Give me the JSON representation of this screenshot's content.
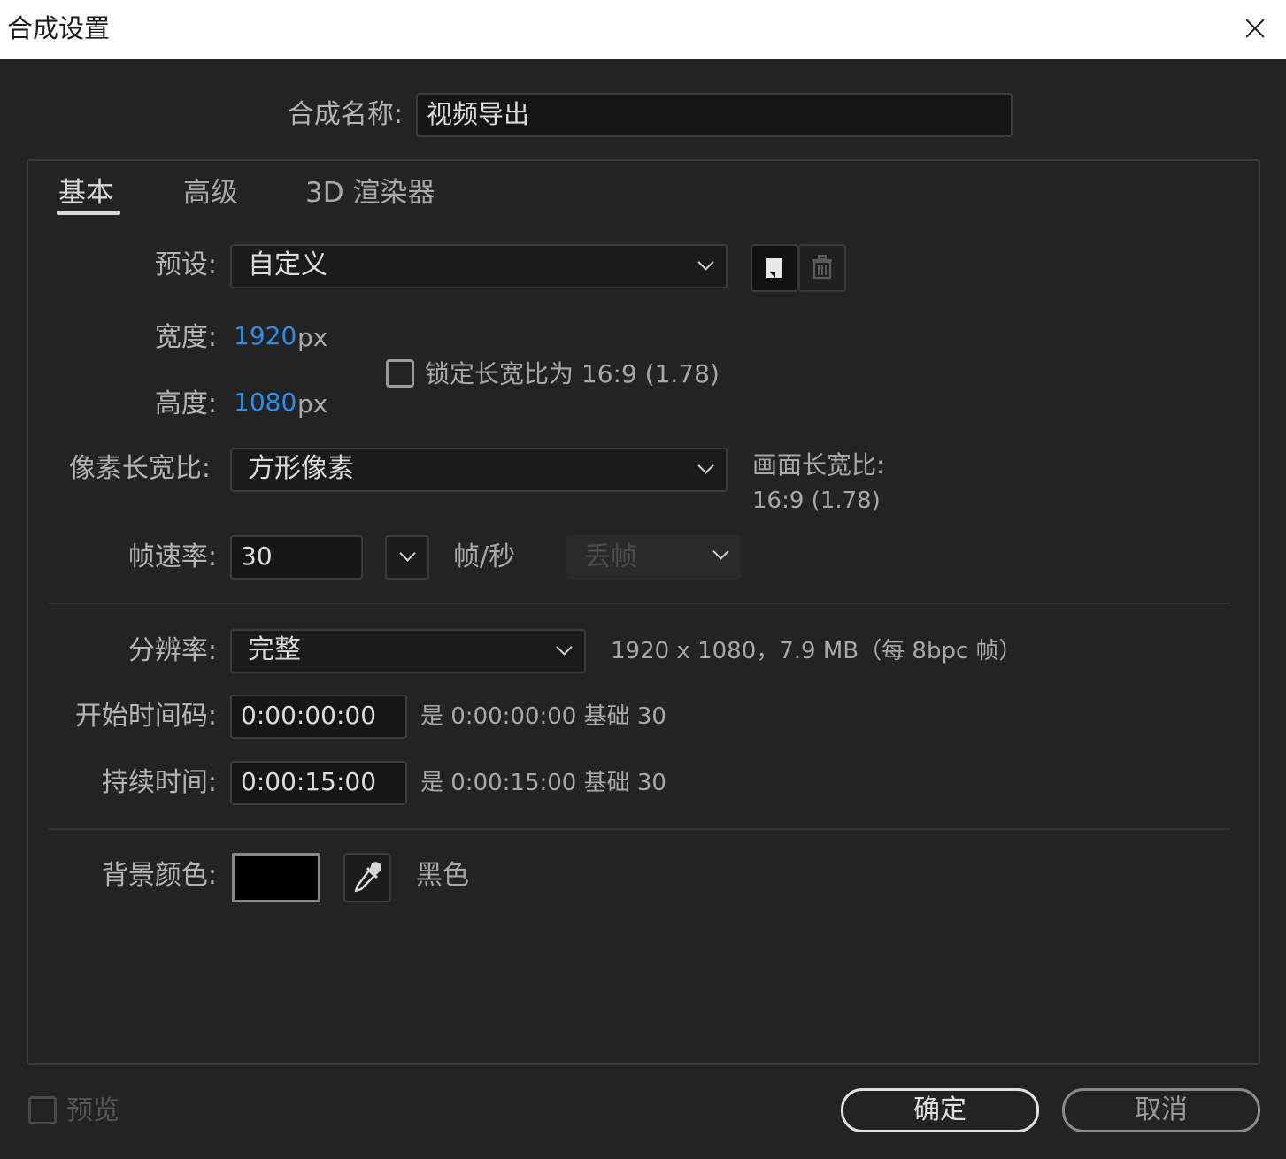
{
  "window": {
    "title": "合成设置"
  },
  "comp_name": {
    "label": "合成名称:",
    "value": "视频导出"
  },
  "tabs": [
    {
      "label": "基本"
    },
    {
      "label": "高级"
    },
    {
      "label": "3D 渲染器"
    }
  ],
  "preset": {
    "label": "预设:",
    "value": "自定义"
  },
  "width": {
    "label": "宽度:",
    "value": "1920",
    "unit": "px"
  },
  "height": {
    "label": "高度:",
    "value": "1080",
    "unit": "px"
  },
  "lock_aspect": {
    "label": "锁定长宽比为 16:9 (1.78)",
    "checked": false
  },
  "pixel_aspect": {
    "label": "像素长宽比:",
    "value": "方形像素"
  },
  "frame_aspect": {
    "label": "画面长宽比:",
    "value": "16:9 (1.78)"
  },
  "frame_rate": {
    "label": "帧速率:",
    "value": "30",
    "unit": "帧/秒",
    "drop_frame": "丢帧"
  },
  "resolution": {
    "label": "分辨率:",
    "value": "完整",
    "info": "1920 x 1080，7.9 MB（每 8bpc 帧）"
  },
  "start_timecode": {
    "label": "开始时间码:",
    "value": "0:00:00:00",
    "info": "是 0:00:00:00  基础 30"
  },
  "duration": {
    "label": "持续时间:",
    "value": "0:00:15:00",
    "info": "是 0:00:15:00  基础 30"
  },
  "background": {
    "label": "背景颜色:",
    "color": "#000000",
    "name": "黑色"
  },
  "footer": {
    "preview_label": "预览",
    "ok_label": "确定",
    "cancel_label": "取消"
  },
  "colors": {
    "accent_blue": "#2d8ceb",
    "background": "#232323",
    "titlebar": "#ffffff"
  }
}
